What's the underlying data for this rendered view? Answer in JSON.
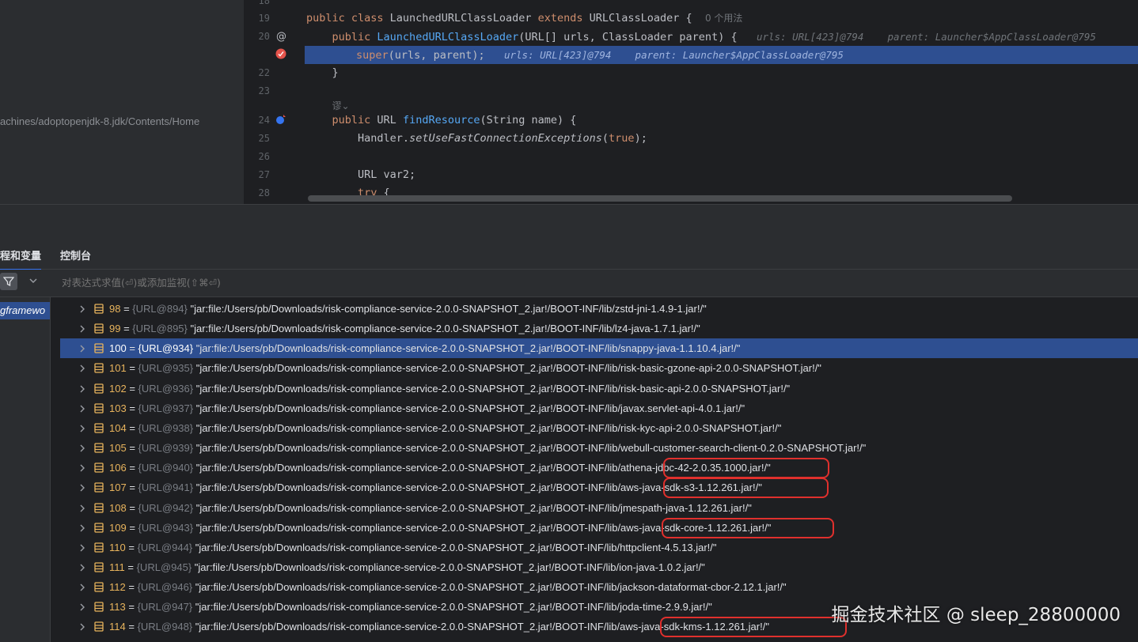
{
  "project": {
    "sdk_path": "achines/adoptopenjdk-8.jdk/Contents/Home"
  },
  "editor": {
    "lines": [
      {
        "num": "18",
        "icon": ""
      },
      {
        "num": "19",
        "icon": ""
      },
      {
        "num": "20",
        "icon": "override-icon"
      },
      {
        "num": "",
        "icon": "breakpoint-icon"
      },
      {
        "num": "22",
        "icon": ""
      },
      {
        "num": "23",
        "icon": ""
      },
      {
        "num": "",
        "icon": ""
      },
      {
        "num": "24",
        "icon": "implement-icon"
      },
      {
        "num": "25",
        "icon": ""
      },
      {
        "num": "26",
        "icon": ""
      },
      {
        "num": "27",
        "icon": ""
      },
      {
        "num": "28",
        "icon": ""
      }
    ],
    "code": {
      "l19_kw": "public class ",
      "l19_name": "LaunchedURLClassLoader ",
      "l19_kw2": "extends ",
      "l19_rest": "URLClassLoader {  ",
      "l19_usages": "0 个用法",
      "l20_kw": "public ",
      "l20_fn": "LaunchedURLClassLoader",
      "l20_rest": "(URL[] urls, ClassLoader parent) {   ",
      "l20_hint": "urls: URL[423]@794    parent: Launcher$AppClassLoader@795",
      "l21_kw": "super",
      "l21_rest": "(urls, parent);   ",
      "l21_hint": "urls: URL[423]@794    parent: Launcher$AppClassLoader@795",
      "l22": "}",
      "l23_hint": "谬⌄",
      "l24_kw": "public ",
      "l24_type": "URL ",
      "l24_fn": "findResource",
      "l24_rest": "(String name) {",
      "l25_cls": "Handler.",
      "l25_fn": "setUseFastConnectionExceptions",
      "l25_open": "(",
      "l25_kw": "true",
      "l25_close": ");",
      "l27": "URL var2;",
      "l28_kw": "try",
      "l28_rest": " {"
    }
  },
  "debug": {
    "tab_threads": "程和变量",
    "tab_console": "控制台",
    "eval_placeholder": "对表达式求值(⏎)或添加监视(⇧⌘⏎)",
    "frame_label": "gframewo"
  },
  "variables": [
    {
      "idx": "98",
      "ref": "{URL@894}",
      "value": "\"jar:file:/Users/pb/Downloads/risk-compliance-service-2.0.0-SNAPSHOT_2.jar!/BOOT-INF/lib/zstd-jni-1.4.9-1.jar!/\""
    },
    {
      "idx": "99",
      "ref": "{URL@895}",
      "value": "\"jar:file:/Users/pb/Downloads/risk-compliance-service-2.0.0-SNAPSHOT_2.jar!/BOOT-INF/lib/lz4-java-1.7.1.jar!/\""
    },
    {
      "idx": "100",
      "ref": "{URL@934}",
      "value": "\"jar:file:/Users/pb/Downloads/risk-compliance-service-2.0.0-SNAPSHOT_2.jar!/BOOT-INF/lib/snappy-java-1.1.10.4.jar!/\""
    },
    {
      "idx": "101",
      "ref": "{URL@935}",
      "value": "\"jar:file:/Users/pb/Downloads/risk-compliance-service-2.0.0-SNAPSHOT_2.jar!/BOOT-INF/lib/risk-basic-gzone-api-2.0.0-SNAPSHOT.jar!/\""
    },
    {
      "idx": "102",
      "ref": "{URL@936}",
      "value": "\"jar:file:/Users/pb/Downloads/risk-compliance-service-2.0.0-SNAPSHOT_2.jar!/BOOT-INF/lib/risk-basic-api-2.0.0-SNAPSHOT.jar!/\""
    },
    {
      "idx": "103",
      "ref": "{URL@937}",
      "value": "\"jar:file:/Users/pb/Downloads/risk-compliance-service-2.0.0-SNAPSHOT_2.jar!/BOOT-INF/lib/javax.servlet-api-4.0.1.jar!/\""
    },
    {
      "idx": "104",
      "ref": "{URL@938}",
      "value": "\"jar:file:/Users/pb/Downloads/risk-compliance-service-2.0.0-SNAPSHOT_2.jar!/BOOT-INF/lib/risk-kyc-api-2.0.0-SNAPSHOT.jar!/\""
    },
    {
      "idx": "105",
      "ref": "{URL@939}",
      "value": "\"jar:file:/Users/pb/Downloads/risk-compliance-service-2.0.0-SNAPSHOT_2.jar!/BOOT-INF/lib/webull-customer-search-client-0.2.0-SNAPSHOT.jar!/\""
    },
    {
      "idx": "106",
      "ref": "{URL@940}",
      "value": "\"jar:file:/Users/pb/Downloads/risk-compliance-service-2.0.0-SNAPSHOT_2.jar!/BOOT-INF/lib/athena-jdbc-42-2.0.35.1000.jar!/\""
    },
    {
      "idx": "107",
      "ref": "{URL@941}",
      "value": "\"jar:file:/Users/pb/Downloads/risk-compliance-service-2.0.0-SNAPSHOT_2.jar!/BOOT-INF/lib/aws-java-sdk-s3-1.12.261.jar!/\""
    },
    {
      "idx": "108",
      "ref": "{URL@942}",
      "value": "\"jar:file:/Users/pb/Downloads/risk-compliance-service-2.0.0-SNAPSHOT_2.jar!/BOOT-INF/lib/jmespath-java-1.12.261.jar!/\""
    },
    {
      "idx": "109",
      "ref": "{URL@943}",
      "value": "\"jar:file:/Users/pb/Downloads/risk-compliance-service-2.0.0-SNAPSHOT_2.jar!/BOOT-INF/lib/aws-java-sdk-core-1.12.261.jar!/\""
    },
    {
      "idx": "110",
      "ref": "{URL@944}",
      "value": "\"jar:file:/Users/pb/Downloads/risk-compliance-service-2.0.0-SNAPSHOT_2.jar!/BOOT-INF/lib/httpclient-4.5.13.jar!/\""
    },
    {
      "idx": "111",
      "ref": "{URL@945}",
      "value": "\"jar:file:/Users/pb/Downloads/risk-compliance-service-2.0.0-SNAPSHOT_2.jar!/BOOT-INF/lib/ion-java-1.0.2.jar!/\""
    },
    {
      "idx": "112",
      "ref": "{URL@946}",
      "value": "\"jar:file:/Users/pb/Downloads/risk-compliance-service-2.0.0-SNAPSHOT_2.jar!/BOOT-INF/lib/jackson-dataformat-cbor-2.12.1.jar!/\""
    },
    {
      "idx": "113",
      "ref": "{URL@947}",
      "value": "\"jar:file:/Users/pb/Downloads/risk-compliance-service-2.0.0-SNAPSHOT_2.jar!/BOOT-INF/lib/joda-time-2.9.9.jar!/\""
    },
    {
      "idx": "114",
      "ref": "{URL@948}",
      "value": "\"jar:file:/Users/pb/Downloads/risk-compliance-service-2.0.0-SNAPSHOT_2.jar!/BOOT-INF/lib/aws-java-sdk-kms-1.12.261.jar!/\""
    }
  ],
  "watermark": "掘金技术社区 @ sleep_28800000",
  "colors": {
    "selection": "#2e4f91",
    "keyword": "#cf8e6d",
    "function": "#56a8f5",
    "index": "#e8b45d",
    "annotation_circle": "#e0302d"
  }
}
